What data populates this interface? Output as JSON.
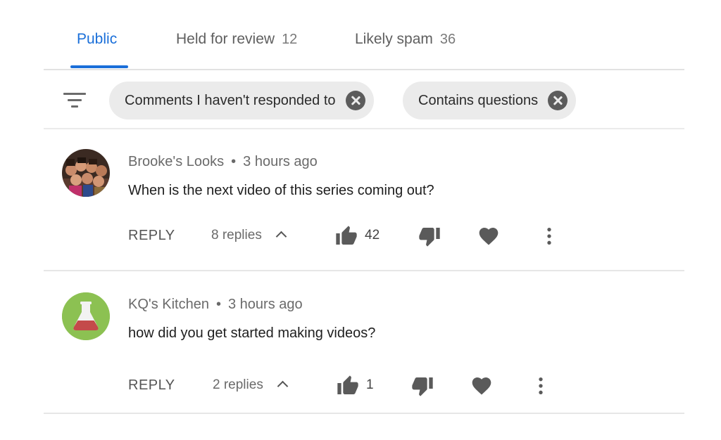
{
  "tabs": [
    {
      "label": "Public",
      "count": ""
    },
    {
      "label": "Held for review",
      "count": "12"
    },
    {
      "label": "Likely spam",
      "count": "36"
    }
  ],
  "active_tab": "Public",
  "filters": [
    {
      "label": "Comments I haven't responded to"
    },
    {
      "label": "Contains questions"
    }
  ],
  "comments": [
    {
      "author": "Brooke's Looks",
      "time": "3 hours ago",
      "text": "When is the next video of this series coming out?",
      "reply_label": "REPLY",
      "replies": "8 replies",
      "likes": "42",
      "avatar": "group-photo"
    },
    {
      "author": "KQ's Kitchen",
      "time": "3 hours ago",
      "text": "how did you get started making videos?",
      "reply_label": "REPLY",
      "replies": "2 replies",
      "likes": "1",
      "avatar": "flask-icon"
    }
  ],
  "icons": {
    "filter": "filter-icon",
    "remove_chip": "close-icon",
    "expand": "chevron-up-icon",
    "like": "thumbs-up-icon",
    "dislike": "thumbs-down-icon",
    "heart": "heart-icon",
    "more": "more-vert-icon"
  },
  "colors": {
    "accent": "#1a6fd9",
    "chip_bg": "#ebebeb",
    "icon": "#5a5a5a",
    "kitchen_avatar_bg": "#8cc152"
  }
}
